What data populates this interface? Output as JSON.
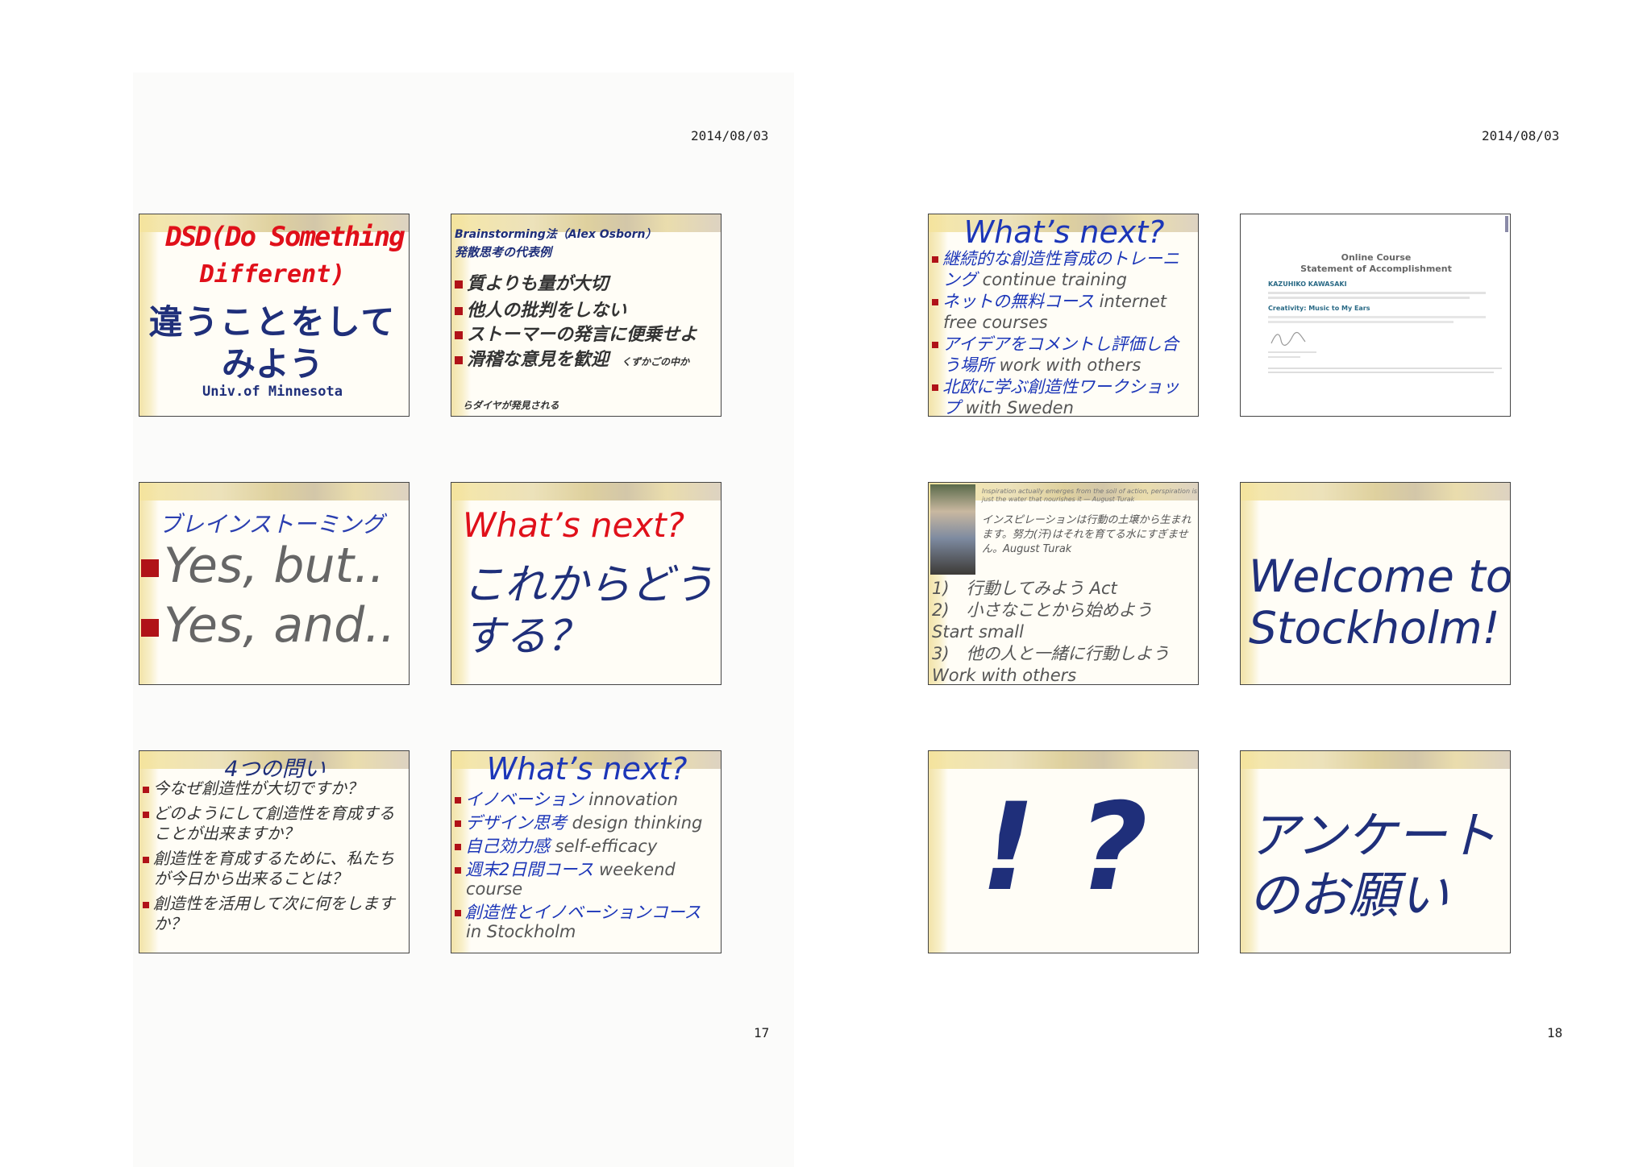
{
  "left_page": {
    "date": "2014/08/03",
    "page_number": "17",
    "slides": {
      "dsd": {
        "line1": "DSD(Do Something",
        "line2": "Different)",
        "line3": "違うことをして",
        "line4": "みよう",
        "line5": "Univ.of Minnesota"
      },
      "brainstorm": {
        "title_line1": "Brainstorming法（Alex Osborn）",
        "title_line2": "発散思考の代表例",
        "items": [
          "質よりも量が大切",
          "他人の批判をしない",
          "ストーマーの発言に便乗せよ",
          "滑稽な意見を歓迎"
        ],
        "note_line1": "くずかごの中か",
        "note_line2": "らダイヤが発見される"
      },
      "yesbut": {
        "title": "ブレインストーミング",
        "item1": "Yes, but..",
        "item2": "Yes, and.."
      },
      "whatsnext_red": {
        "title": "What’s next?",
        "line1": "これからどう",
        "line2": "する？"
      },
      "four_questions": {
        "title": "4つの問い",
        "items": [
          "今なぜ創造性が大切ですか？",
          "どのようにして創造性を育成することが出来ますか？",
          "創造性を育成するために、私たちが今日から出来ることは？",
          "創造性を活用して次に何をしますか？"
        ]
      },
      "whatsnext_innov": {
        "title": "What’s next?",
        "items": [
          {
            "jp": "イノベーション",
            "en": " innovation"
          },
          {
            "jp": "デザイン思考",
            "en": " design thinking"
          },
          {
            "jp": "自己効力感",
            "en": " self-efficacy"
          },
          {
            "jp": "週末2日間コース",
            "en": " weekend course"
          },
          {
            "jp": "創造性とイノベーションコース",
            "en": " in Stockholm"
          }
        ]
      }
    }
  },
  "right_page": {
    "date": "2014/08/03",
    "page_number": "18",
    "slides": {
      "whatsnext_training": {
        "title": "What’s next?",
        "items": [
          {
            "jp": "継続的な創造性育成のトレーニング",
            "en": " continue training"
          },
          {
            "jp": "ネットの無料コース",
            "en": " internet free courses"
          },
          {
            "jp": "アイデアをコメントし評価し合う場所",
            "en": " work with others"
          },
          {
            "jp": "北欧に学ぶ創造性ワークショップ",
            "en": " with Sweden"
          }
        ]
      },
      "certificate": {
        "heading1": "Online Course",
        "heading2": "Statement of Accomplishment",
        "name": "KAZUHIKO KAWASAKI",
        "course": "Creativity: Music to My Ears"
      },
      "turak": {
        "quote_en": "Inspiration actually emerges from the soil of action, perspiration is just the water that nourishes it — August Turak",
        "quote_jp": "インスピレーションは行動の土壌から生まれます。努力(汗)はそれを育てる水にすぎません。August Turak",
        "lines": [
          "1)　行動してみよう Act",
          "2)　小さなことから始めよう",
          "Start small",
          "3)　他の人と一緒に行動しよう",
          "Work with others"
        ]
      },
      "welcome": {
        "line1": "Welcome to",
        "line2": "Stockholm!"
      },
      "exclaim": {
        "text": "! ?"
      },
      "survey": {
        "line1": "アンケート",
        "line2": "のお願い"
      }
    }
  }
}
